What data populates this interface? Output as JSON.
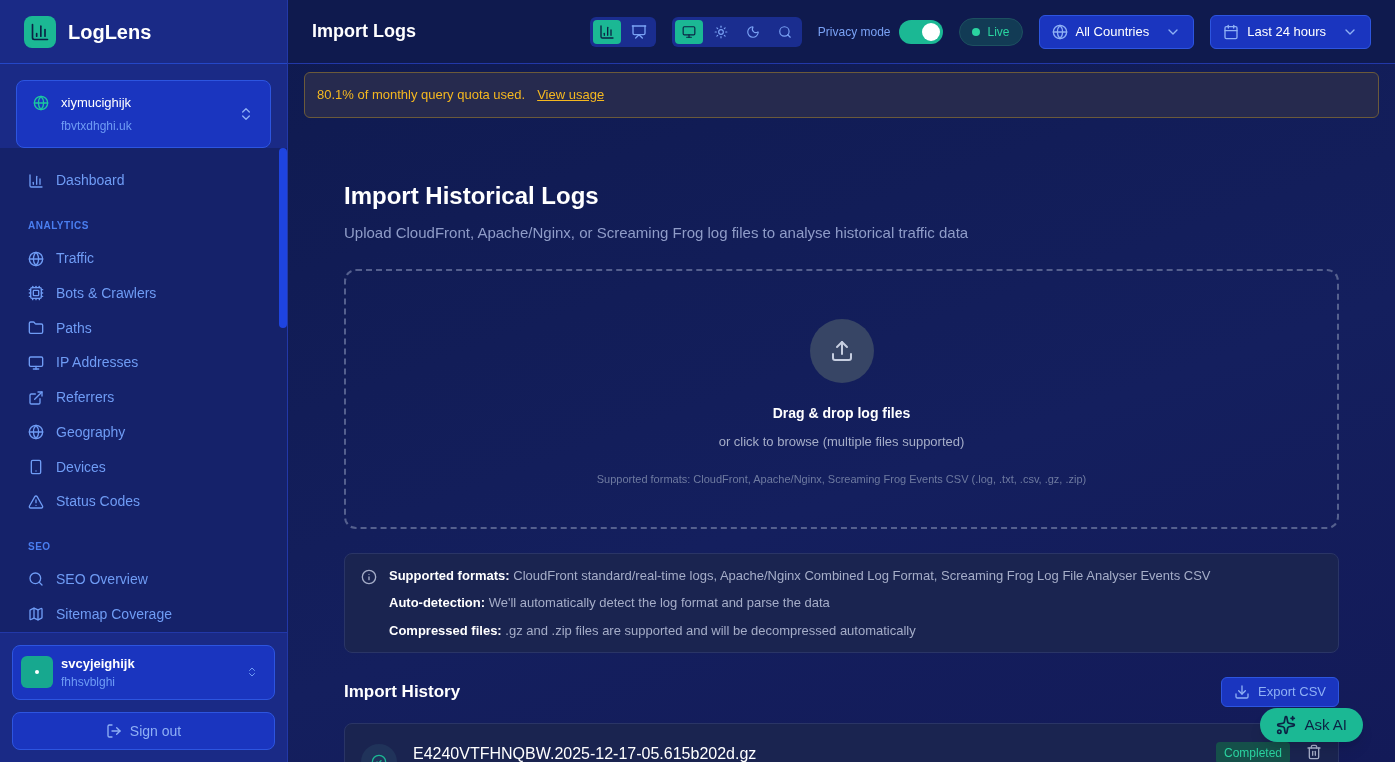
{
  "brand": {
    "name": "LogLens"
  },
  "site": {
    "name": "xiymucighijk",
    "domain": "fbvtxdhghi.uk"
  },
  "nav": [
    {
      "kind": "item",
      "label": "Dashboard"
    },
    {
      "kind": "section",
      "label": "ANALYTICS"
    },
    {
      "kind": "item",
      "label": "Traffic"
    },
    {
      "kind": "item",
      "label": "Bots & Crawlers"
    },
    {
      "kind": "item",
      "label": "Paths"
    },
    {
      "kind": "item",
      "label": "IP Addresses"
    },
    {
      "kind": "item",
      "label": "Referrers"
    },
    {
      "kind": "item",
      "label": "Geography"
    },
    {
      "kind": "item",
      "label": "Devices"
    },
    {
      "kind": "item",
      "label": "Status Codes"
    },
    {
      "kind": "section",
      "label": "SEO"
    },
    {
      "kind": "item",
      "label": "SEO Overview"
    },
    {
      "kind": "item",
      "label": "Sitemap Coverage"
    }
  ],
  "user": {
    "name": "svcyjeighijk",
    "sub": "fhhsvblghi"
  },
  "sign_out": "Sign out",
  "header": {
    "title": "Import Logs",
    "view_buttons": [
      {
        "selected": true
      },
      {
        "selected": false
      }
    ],
    "theme_buttons": [
      {
        "selected": true
      },
      {
        "selected": false
      },
      {
        "selected": false
      },
      {
        "selected": false
      }
    ],
    "privacy": {
      "label": "Privacy mode",
      "on": true
    },
    "live": "Live",
    "country": "All Countries",
    "range": "Last 24 hours"
  },
  "alert": {
    "text": "80.1% of monthly query quota used.",
    "link": "View usage"
  },
  "import": {
    "title": "Import Historical Logs",
    "subtitle": "Upload CloudFront, Apache/Nginx, or Screaming Frog log files to analyse historical traffic data",
    "drop_title": "Drag & drop log files",
    "drop_sub": "or click to browse (multiple files supported)",
    "drop_formats": "Supported formats: CloudFront, Apache/Nginx, Screaming Frog Events CSV (.log, .txt, .csv, .gz, .zip)"
  },
  "info": [
    "**Supported formats:** CloudFront standard/real-time logs, Apache/Nginx Combined Log Format, Screaming Frog Log File Analyser Events CSV",
    "**Auto-detection:** We'll automatically detect the log format and parse the data",
    "**Compressed files:** .gz and .zip files are supported and will be decompressed automatically"
  ],
  "history": {
    "title": "Import History",
    "export": "Export CSV",
    "rows": [
      {
        "file": "E4240VTFHNQBW.2025-12-17-05.615b202d.gz",
        "status": "Completed"
      }
    ]
  },
  "ask_ai": "Ask AI"
}
